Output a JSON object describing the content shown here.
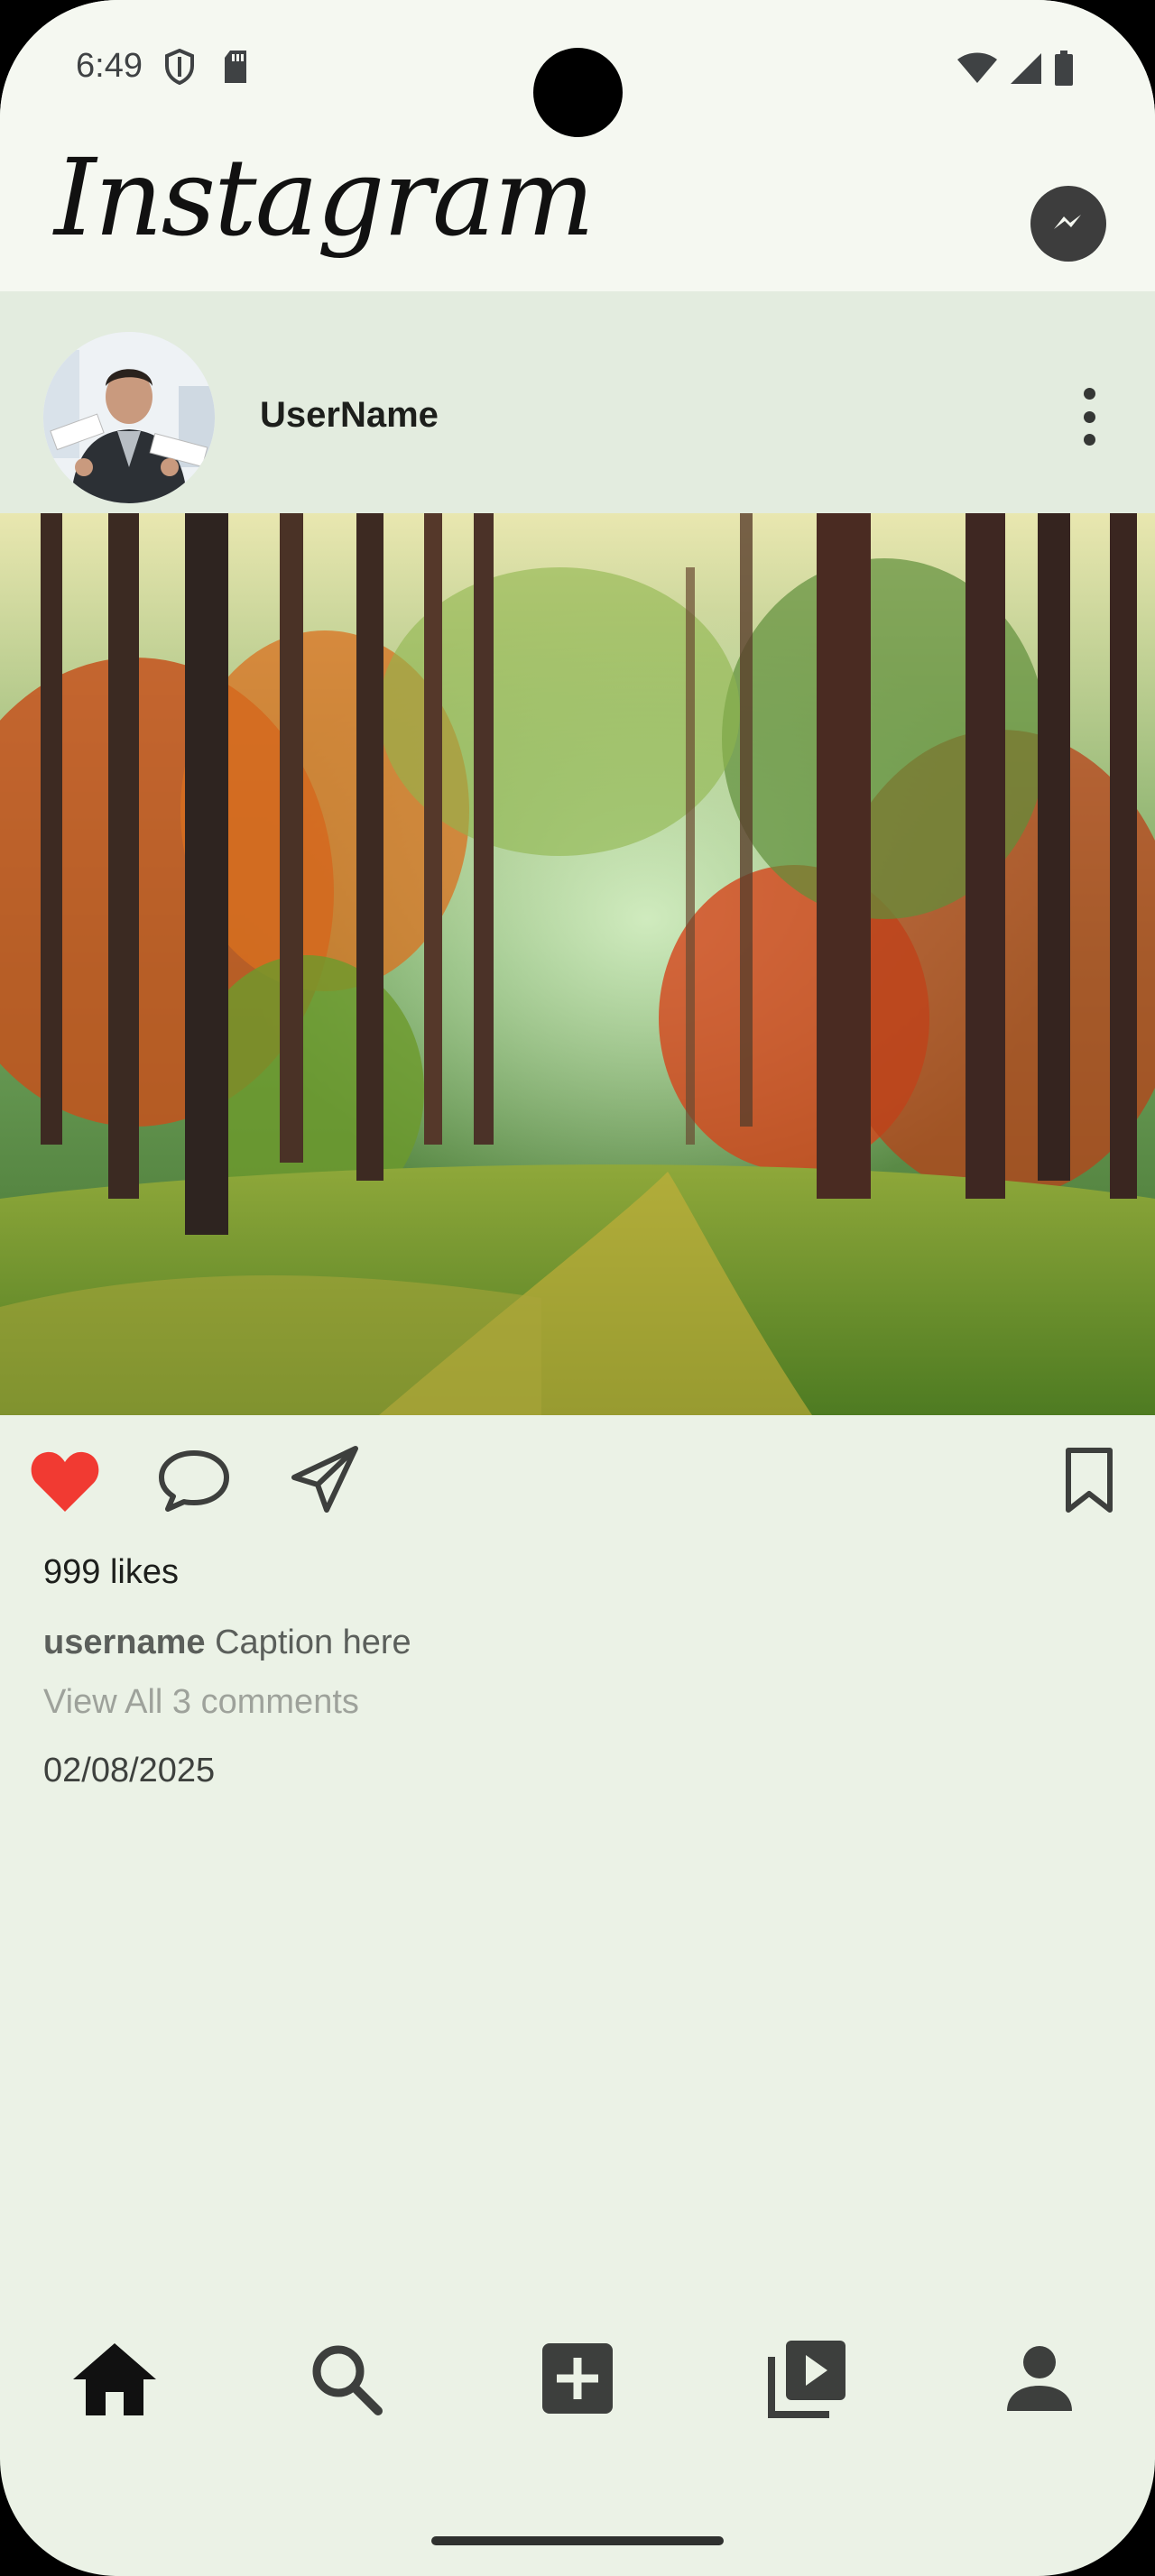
{
  "status_bar": {
    "time": "6:49",
    "left_icons": [
      "shield-icon",
      "sd-card-icon"
    ],
    "right_icons": [
      "wifi-icon",
      "signal-icon",
      "battery-icon"
    ]
  },
  "app_bar": {
    "brand": "Instagram",
    "messenger_icon": "messenger-icon"
  },
  "post": {
    "username": "UserName",
    "menu_icon": "more-vertical-icon",
    "image_alt": "forest-path-photo",
    "liked": true,
    "likes_text": "999 likes",
    "caption_user": "username",
    "caption_text": " Caption here",
    "view_comments": "View All 3 comments",
    "date": "02/08/2025"
  },
  "actions": {
    "like_icon": "heart-icon",
    "comment_icon": "comment-icon",
    "share_icon": "send-icon",
    "save_icon": "bookmark-icon"
  },
  "bottom_nav": {
    "items": [
      "home-icon",
      "search-icon",
      "add-post-icon",
      "reels-icon",
      "profile-icon"
    ],
    "active": "home"
  },
  "colors": {
    "background": "#ebf2e6",
    "appbar": "#f5f8f1",
    "post_header": "#e3ecdf",
    "like_red": "#f13a32",
    "icon_dark": "#3d3f3d"
  }
}
